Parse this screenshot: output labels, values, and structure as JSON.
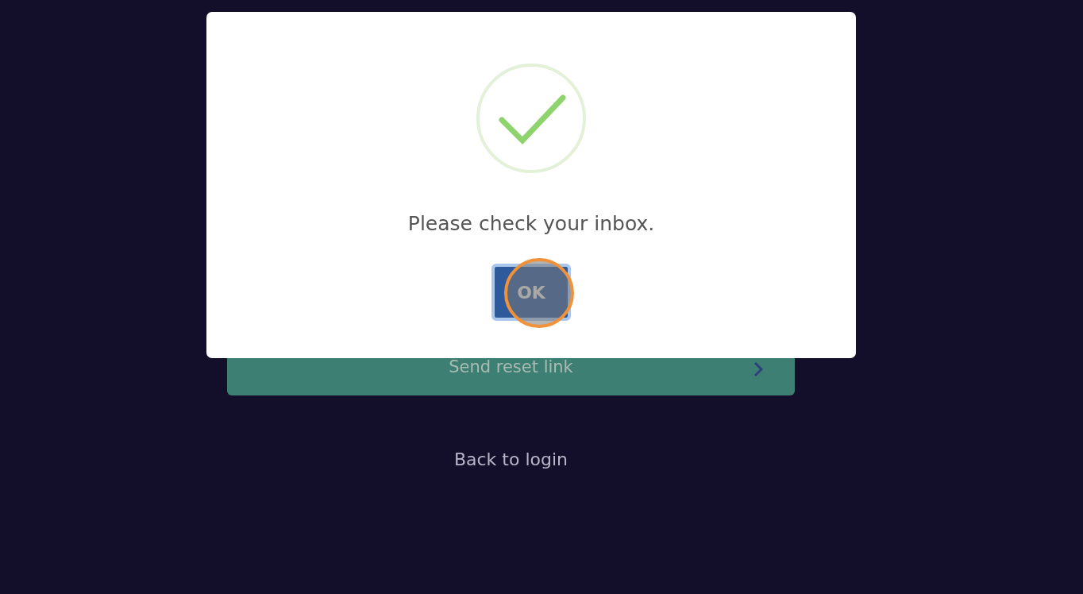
{
  "form": {
    "submit_button": "Send reset link",
    "back_link": "Back to login"
  },
  "modal": {
    "message": "Please check your inbox.",
    "confirm_button": "OK"
  }
}
